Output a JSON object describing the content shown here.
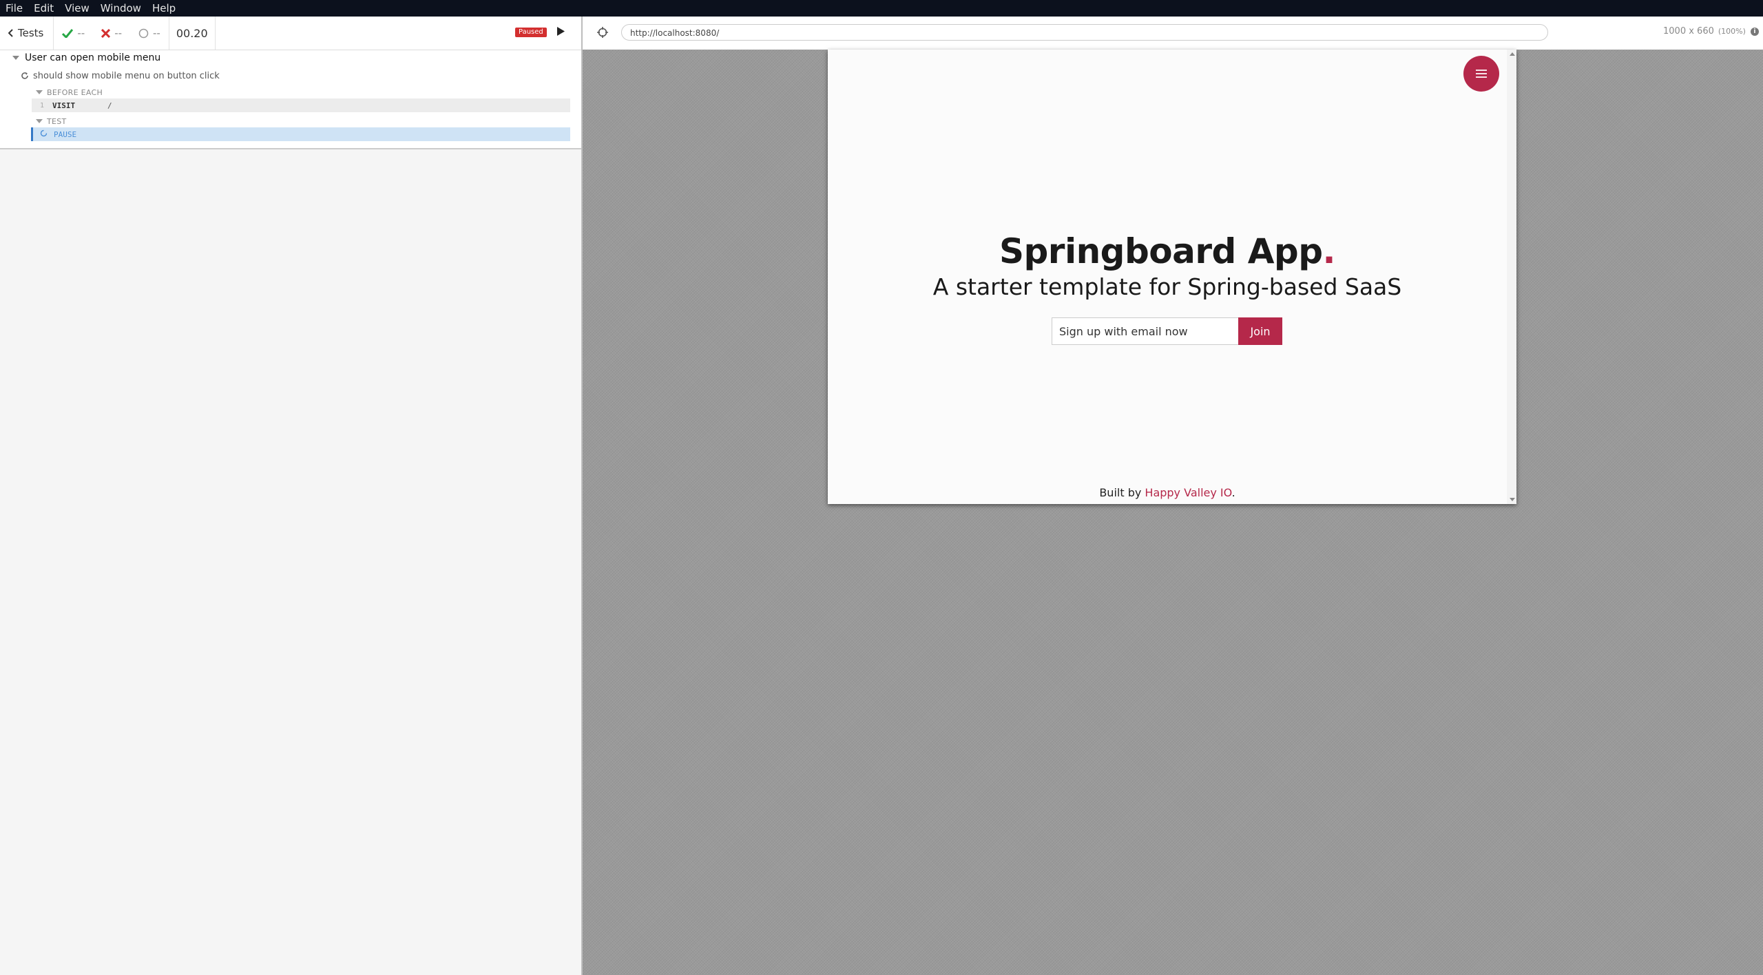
{
  "menubar": {
    "items": [
      "File",
      "Edit",
      "View",
      "Window",
      "Help"
    ]
  },
  "reporter": {
    "tests_label": "Tests",
    "passed": "--",
    "failed": "--",
    "pending": "--",
    "duration": "00.20",
    "paused_badge": "Paused",
    "suite_title": "User can open mobile menu",
    "test_title": "should show mobile menu on button click",
    "before_each_label": "BEFORE EACH",
    "test_label": "TEST",
    "commands": [
      {
        "num": "1",
        "name": "VISIT",
        "message": "/"
      },
      {
        "num": "",
        "name": "PAUSE",
        "message": ""
      }
    ]
  },
  "aut": {
    "url": "http://localhost:8080/",
    "viewport": "1000 x 660",
    "scale": "(100%)"
  },
  "app": {
    "title": "Springboard App",
    "title_dot": ".",
    "subtitle": "A starter template for Spring-based SaaS",
    "email_placeholder": "Sign up with email now",
    "join_label": "Join",
    "footer_prefix": "Built by ",
    "footer_link": "Happy Valley IO",
    "footer_suffix": ".",
    "accent_color": "#b5284a"
  }
}
